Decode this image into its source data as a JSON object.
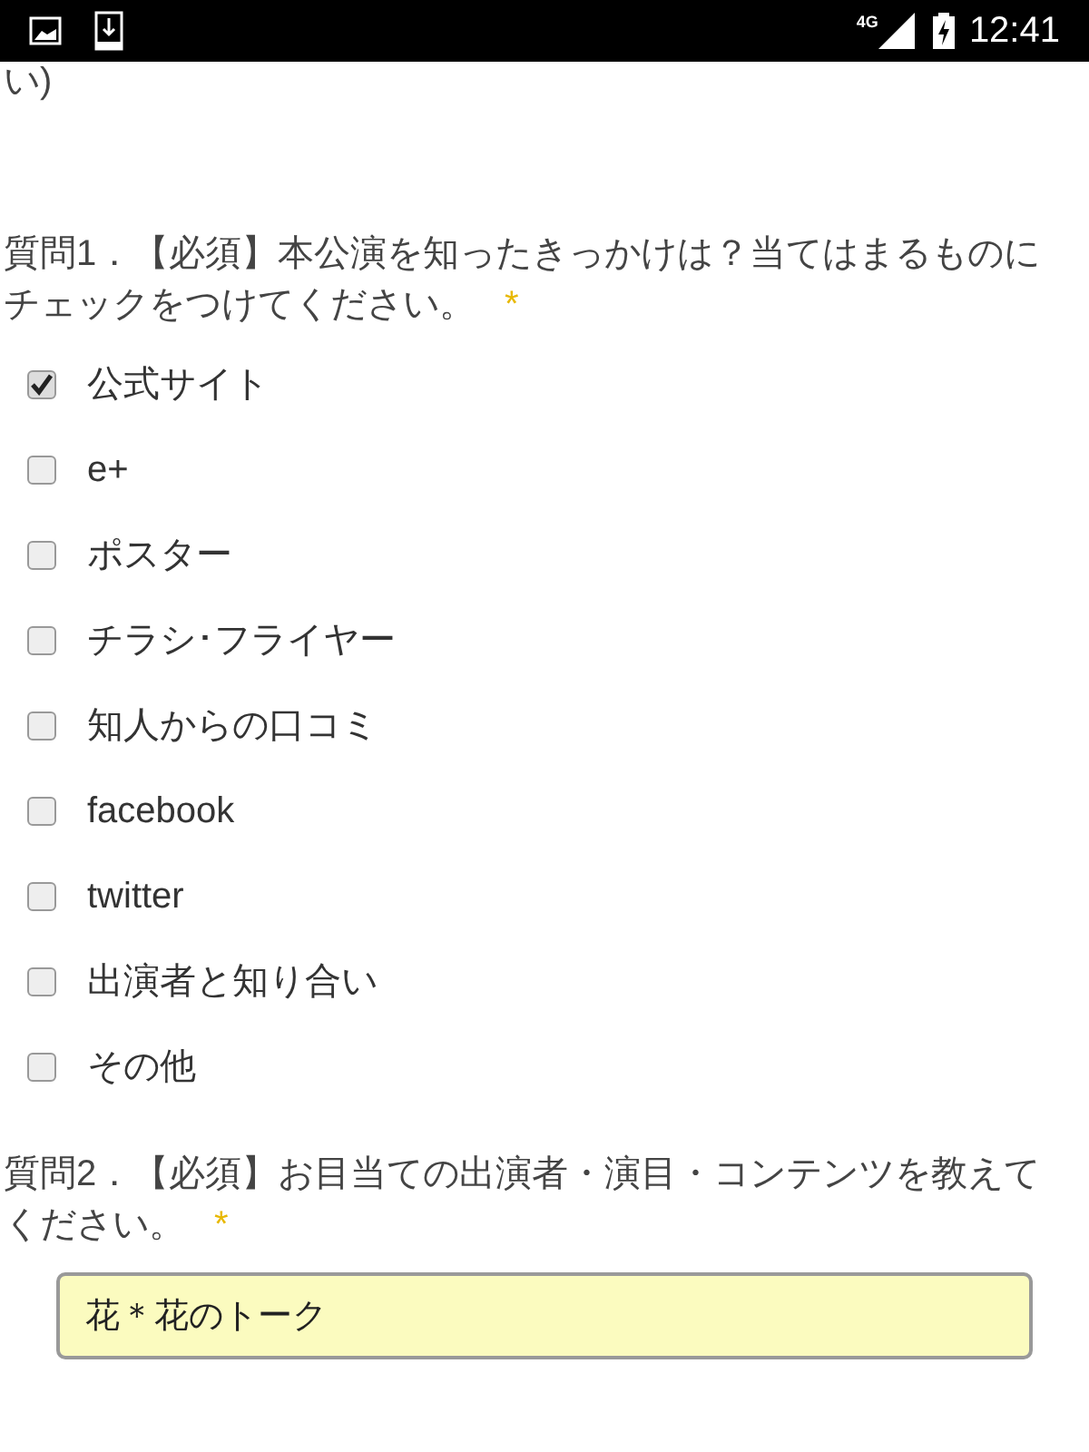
{
  "status_bar": {
    "time": "12:41",
    "network": "4G"
  },
  "previous_text": "い)",
  "questions": [
    {
      "label": "質問1．【必須】本公演を知ったきっかけは？当てはまるものにチェックをつけてください。",
      "required_mark": "*",
      "kind": "checkboxes",
      "options": [
        {
          "label": "公式サイト",
          "checked": true
        },
        {
          "label": "e+",
          "checked": false
        },
        {
          "label": "ポスター",
          "checked": false
        },
        {
          "label": "チラシ･フライヤー",
          "checked": false
        },
        {
          "label": "知人からの口コミ",
          "checked": false
        },
        {
          "label": "facebook",
          "checked": false
        },
        {
          "label": "twitter",
          "checked": false
        },
        {
          "label": "出演者と知り合い",
          "checked": false
        },
        {
          "label": "その他",
          "checked": false
        }
      ]
    },
    {
      "label": "質問2．【必須】お目当ての出演者・演目・コンテンツを教えてください。",
      "required_mark": "*",
      "kind": "text",
      "value": "花＊花のトーク"
    }
  ]
}
